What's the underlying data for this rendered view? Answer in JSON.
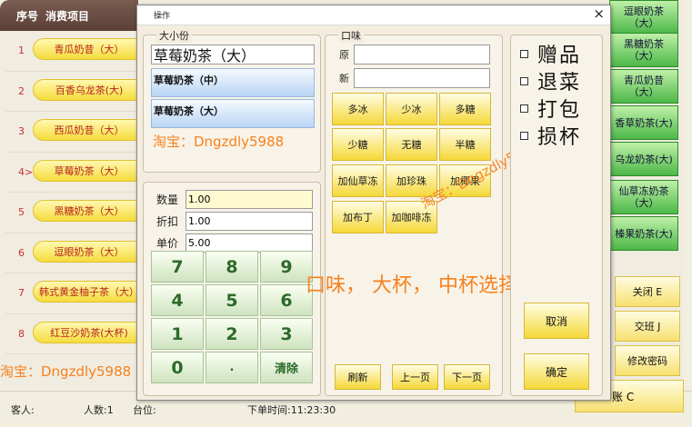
{
  "background": {
    "header": {
      "seq": "序号",
      "item": "消费项目"
    },
    "orders": [
      {
        "num": "1",
        "name": "青瓜奶昔（大）"
      },
      {
        "num": "2",
        "name": "百香乌龙茶(大)"
      },
      {
        "num": "3",
        "name": "西瓜奶昔（大）"
      },
      {
        "num": "4>",
        "name": "草莓奶茶（大）"
      },
      {
        "num": "5",
        "name": "黑糖奶茶（大）"
      },
      {
        "num": "6",
        "name": "逗眼奶茶（大）"
      },
      {
        "num": "7",
        "name": "韩式黄金柚子茶（大）"
      },
      {
        "num": "8",
        "name": "红豆沙奶茶(大杯)"
      }
    ],
    "menu_items": [
      "逗眼奶茶（大）",
      "黑糖奶茶（大）",
      "青瓜奶昔（大）",
      "香草奶茶(大)",
      "乌龙奶茶(大)",
      "仙草冻奶茶（大）",
      "榛果奶茶(大)"
    ],
    "func_buttons": {
      "close": "关闭 E",
      "shift": "交班 J",
      "change_pwd": "修改密码"
    },
    "pay_button": "账 C",
    "footer": {
      "guest": "客人:",
      "people": "人数:1",
      "table": "台位:",
      "order_time": "下单时间:11:23:30"
    },
    "watermark": "淘宝：Dngzdly5988"
  },
  "dialog": {
    "title": "操作",
    "close_icon": "×",
    "size_group": {
      "legend": "大小份",
      "current": "草莓奶茶（大）",
      "options": [
        "草莓奶茶（中）",
        "草莓奶茶（大）"
      ],
      "watermark": "淘宝：Dngzdly5988"
    },
    "quantity_group": {
      "qty_label": "数量",
      "qty_value": "1.00",
      "discount_label": "折扣",
      "discount_value": "1.00",
      "price_label": "单价",
      "price_value": "5.00",
      "keys": [
        "7",
        "8",
        "9",
        "4",
        "5",
        "6",
        "1",
        "2",
        "3",
        "0",
        ".",
        "清除"
      ]
    },
    "taste_group": {
      "legend": "口味",
      "orig_label": "原",
      "new_label": "新",
      "buttons": [
        "多冰",
        "少冰",
        "多糖",
        "少糖",
        "无糖",
        "半糖",
        "加仙草冻",
        "加珍珠",
        "加椰果",
        "加布丁",
        "加咖啡冻"
      ],
      "refresh": "刷新",
      "prev": "上一页",
      "next": "下一页",
      "watermark": "淘宝：Dngzdly5988"
    },
    "hint": "口味，  大杯，  中杯选择",
    "options_group": {
      "checks": [
        "赠品",
        "退菜",
        "打包",
        "损杯"
      ],
      "cancel": "取消",
      "confirm": "确定"
    }
  }
}
